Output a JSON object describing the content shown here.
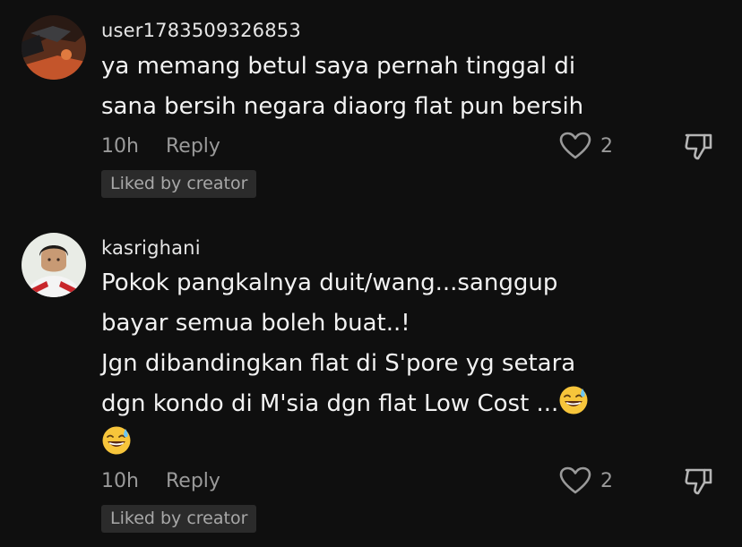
{
  "comments": [
    {
      "username": "user1783509326853",
      "lines": [
        "ya memang betul saya pernah tinggal di",
        "sana bersih negara diaorg flat pun bersih"
      ],
      "time": "10h",
      "reply_label": "Reply",
      "like_count": "2",
      "badge": "Liked by creator"
    },
    {
      "username": "kasrighani",
      "lines": [
        "Pokok pangkalnya duit/wang...sanggup",
        "bayar semua boleh buat..!",
        "Jgn dibandingkan flat di S'pore yg setara",
        "dgn kondo di M'sia dgn flat Low Cost ..."
      ],
      "emoji": "grinning-face-with-sweat",
      "time": "10h",
      "reply_label": "Reply",
      "like_count": "2",
      "badge": "Liked by creator"
    }
  ],
  "icons": {
    "like": "heart-outline-icon",
    "dislike": "thumbs-down-outline-icon"
  },
  "colors": {
    "background": "#0f0f0f",
    "text": "#f2f2f2",
    "muted": "#9a9a9a",
    "badge_bg": "#2b2b2b"
  }
}
